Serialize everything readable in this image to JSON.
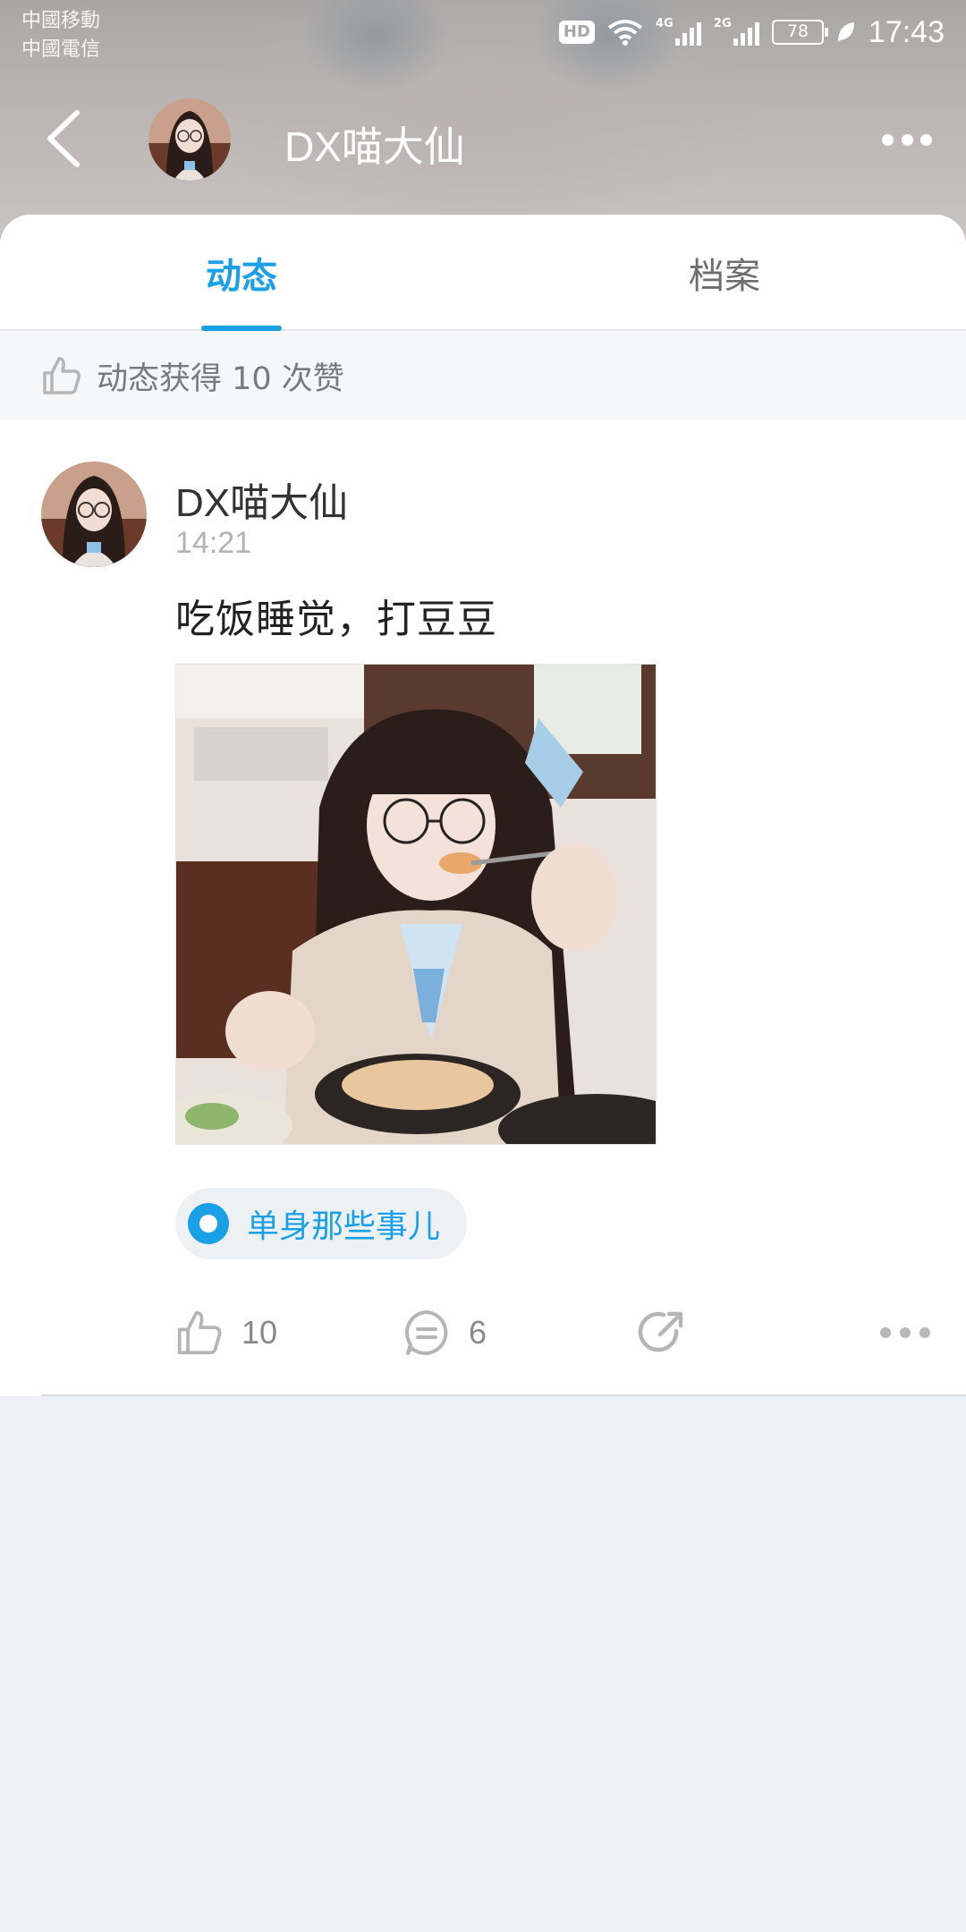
{
  "status_bar": {
    "carrier_1": "中國移動",
    "carrier_2": "中國電信",
    "hd": "HD",
    "net_1": "4G",
    "net_2": "2G",
    "battery": "78",
    "time": "17:43"
  },
  "header": {
    "title": "DX喵大仙"
  },
  "tabs": [
    {
      "label": "动态",
      "active": true
    },
    {
      "label": "档案",
      "active": false
    }
  ],
  "like_summary": "动态获得 10 次赞",
  "post": {
    "author": "DX喵大仙",
    "time": "14:21",
    "text": "吃饭睡觉，打豆豆",
    "topic": "单身那些事儿",
    "likes": "10",
    "comments": "6"
  },
  "colors": {
    "accent": "#1aa0e6",
    "page_bg": "#eef1f4"
  }
}
